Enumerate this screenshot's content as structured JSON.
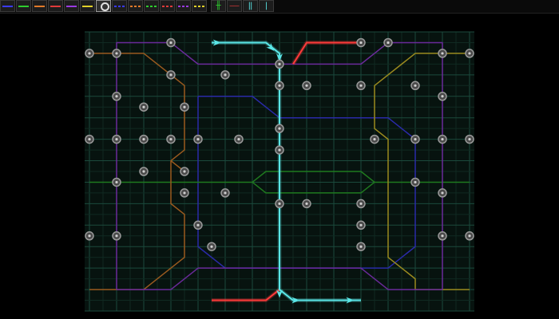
{
  "colors": {
    "background": "#000000",
    "board": "#07130f",
    "grid_minor": "#102a22",
    "grid_major": "#1b4a3c",
    "node_fill": "#4a4a4a",
    "node_ring": "#9a9a9a",
    "lines": {
      "blue": "#2a2aa8",
      "green": "#1f7a1f",
      "orange": "#9a5a1f",
      "red": "#ff3a3a",
      "purple": "#6a2a9a",
      "yellow": "#9a8a1f",
      "cyan": "#5ae6e6"
    }
  },
  "toolbar": {
    "line_tools": [
      {
        "name": "blue-line-tool",
        "color": "#3a3aff",
        "style": "solid"
      },
      {
        "name": "green-line-tool",
        "color": "#2ecc2e",
        "style": "solid"
      },
      {
        "name": "orange-line-tool",
        "color": "#e07a2a",
        "style": "solid"
      },
      {
        "name": "red-line-tool",
        "color": "#e03a3a",
        "style": "solid"
      },
      {
        "name": "purple-line-tool",
        "color": "#9a3ae0",
        "style": "solid"
      },
      {
        "name": "yellow-line-tool",
        "color": "#e0d02a",
        "style": "solid"
      }
    ],
    "station_tool": {
      "name": "station-tool",
      "icon": "station-ring-icon",
      "selected": true
    },
    "dashed_tools": [
      {
        "name": "blue-dashed-tool",
        "color": "#3a3aff",
        "style": "dashed"
      },
      {
        "name": "orange-dashed-tool",
        "color": "#e07a2a",
        "style": "dashed"
      },
      {
        "name": "green-dashed-tool",
        "color": "#2ecc2e",
        "style": "dashed"
      },
      {
        "name": "red-dashed-tool",
        "color": "#e03a3a",
        "style": "dashed"
      },
      {
        "name": "purple-dashed-tool",
        "color": "#9a3ae0",
        "style": "dashed"
      },
      {
        "name": "yellow-dashed-tool",
        "color": "#e0d02a",
        "style": "dashed"
      }
    ],
    "special_tools": [
      {
        "name": "vertical-crossing-tool",
        "icon": "vertical-crossing-icon",
        "color": "#2ecc2e"
      },
      {
        "name": "horizontal-dash-tool",
        "icon": "horizontal-dash-icon",
        "color": "#e03a3a"
      },
      {
        "name": "bridge-tool",
        "icon": "bridge-icon",
        "color": "#5ae6e6"
      },
      {
        "name": "pipe-tool",
        "icon": "pipe-icon",
        "color": "#5ae6e6"
      }
    ]
  },
  "map": {
    "lines": [
      {
        "name": "blue-line",
        "color": "blue",
        "path": [
          [
            4,
            3
          ],
          [
            4,
            10
          ],
          [
            5,
            11
          ],
          [
            11,
            11
          ],
          [
            12,
            10
          ],
          [
            12,
            5
          ],
          [
            11,
            4
          ],
          [
            7,
            4
          ],
          [
            6,
            3
          ],
          [
            4,
            3
          ]
        ]
      },
      {
        "name": "green-line",
        "color": "green",
        "path": [
          [
            0,
            7
          ],
          [
            6,
            7
          ],
          [
            6.5,
            6.5
          ],
          [
            10,
            6.5
          ],
          [
            10.5,
            7
          ],
          [
            14,
            7
          ]
        ]
      },
      {
        "name": "green-line-lower",
        "color": "green",
        "path": [
          [
            6,
            7
          ],
          [
            6.5,
            7.5
          ],
          [
            10,
            7.5
          ],
          [
            10.5,
            7
          ]
        ]
      },
      {
        "name": "orange-line-left",
        "color": "orange",
        "path": [
          [
            0,
            1
          ],
          [
            2,
            1
          ],
          [
            3,
            2
          ],
          [
            3.5,
            2.5
          ],
          [
            3.5,
            5.5
          ],
          [
            3,
            6
          ],
          [
            3,
            8
          ],
          [
            3.5,
            8.5
          ],
          [
            3.5,
            10.5
          ],
          [
            2,
            12
          ],
          [
            0,
            12
          ]
        ]
      },
      {
        "name": "orange-line-mid",
        "color": "orange",
        "path": [
          [
            3,
            6
          ],
          [
            3.5,
            6.5
          ]
        ]
      },
      {
        "name": "yellow-line-right",
        "color": "yellow",
        "path": [
          [
            14,
            1
          ],
          [
            12,
            1
          ],
          [
            10.5,
            2.5
          ],
          [
            10.5,
            4.5
          ],
          [
            11,
            5
          ],
          [
            11,
            9.5
          ],
          [
            11,
            10.5
          ],
          [
            12,
            11.5
          ],
          [
            12,
            12
          ],
          [
            14,
            12
          ]
        ]
      },
      {
        "name": "purple-line-left",
        "color": "purple",
        "path": [
          [
            1,
            12
          ],
          [
            1,
            1
          ],
          [
            1,
            0.5
          ],
          [
            3,
            0.5
          ],
          [
            4,
            1.5
          ],
          [
            7,
            1.5
          ]
        ]
      },
      {
        "name": "purple-line-right",
        "color": "purple",
        "path": [
          [
            13,
            12
          ],
          [
            13,
            1
          ],
          [
            13,
            0.5
          ],
          [
            11,
            0.5
          ],
          [
            10,
            1.5
          ],
          [
            7,
            1.5
          ]
        ]
      },
      {
        "name": "purple-line-bottom",
        "color": "purple",
        "path": [
          [
            1,
            12
          ],
          [
            3,
            12
          ],
          [
            4,
            11
          ],
          [
            7,
            11
          ],
          [
            10,
            11
          ],
          [
            11,
            12
          ],
          [
            13,
            12
          ]
        ]
      },
      {
        "name": "red-line-top",
        "color": "red",
        "path": [
          [
            7.5,
            1.5
          ],
          [
            8,
            0.5
          ],
          [
            10,
            0.5
          ]
        ]
      },
      {
        "name": "red-line-bottom",
        "color": "red",
        "path": [
          [
            4.5,
            12.5
          ],
          [
            6.5,
            12.5
          ],
          [
            7,
            12
          ]
        ]
      },
      {
        "name": "cyan-line",
        "color": "cyan",
        "path": [
          [
            4.5,
            0.5
          ],
          [
            6.5,
            0.5
          ],
          [
            7,
            1
          ],
          [
            7,
            12
          ],
          [
            7.5,
            12.5
          ],
          [
            10,
            12.5
          ]
        ]
      }
    ],
    "stations": [
      [
        3,
        0.5
      ],
      [
        10,
        0.5
      ],
      [
        11,
        0.5
      ],
      [
        0,
        1
      ],
      [
        1,
        1
      ],
      [
        13,
        1
      ],
      [
        14,
        1
      ],
      [
        7,
        1.5
      ],
      [
        3,
        2
      ],
      [
        5,
        2
      ],
      [
        7,
        2.5
      ],
      [
        8,
        2.5
      ],
      [
        10,
        2.5
      ],
      [
        12,
        2.5
      ],
      [
        1,
        3
      ],
      [
        13,
        3
      ],
      [
        2,
        3.5
      ],
      [
        3.5,
        3.5
      ],
      [
        7,
        4.5
      ],
      [
        0,
        5
      ],
      [
        1,
        5
      ],
      [
        2,
        5
      ],
      [
        3,
        5
      ],
      [
        4,
        5
      ],
      [
        5.5,
        5
      ],
      [
        10.5,
        5
      ],
      [
        12,
        5
      ],
      [
        13,
        5
      ],
      [
        14,
        5
      ],
      [
        7,
        5.5
      ],
      [
        2,
        6.5
      ],
      [
        3.5,
        6.5
      ],
      [
        1,
        7
      ],
      [
        12,
        7
      ],
      [
        3.5,
        7.5
      ],
      [
        5,
        7.5
      ],
      [
        13,
        7.5
      ],
      [
        7,
        8
      ],
      [
        8,
        8
      ],
      [
        10,
        8
      ],
      [
        4,
        9
      ],
      [
        10,
        9
      ],
      [
        0,
        9.5
      ],
      [
        1,
        9.5
      ],
      [
        13,
        9.5
      ],
      [
        14,
        9.5
      ],
      [
        4.5,
        10
      ],
      [
        10,
        10
      ]
    ],
    "arrows": [
      {
        "name": "arrow-cyan-start",
        "at": [
          4.7,
          0.5
        ],
        "dir": "right",
        "color": "cyan"
      },
      {
        "name": "arrow-cyan-top",
        "at": [
          6.7,
          0.75
        ],
        "dir": "down-right",
        "color": "cyan"
      },
      {
        "name": "arrow-cyan-junction-top",
        "at": [
          7,
          1.2
        ],
        "dir": "down",
        "color": "cyan"
      },
      {
        "name": "arrow-cyan-junction-bottom",
        "at": [
          7,
          12.2
        ],
        "dir": "down",
        "color": "cyan"
      },
      {
        "name": "arrow-cyan-bottom",
        "at": [
          7.6,
          12.5
        ],
        "dir": "right",
        "color": "cyan"
      },
      {
        "name": "arrow-cyan-end",
        "at": [
          9.6,
          12.5
        ],
        "dir": "right",
        "color": "cyan"
      }
    ],
    "cols": 14,
    "rows": 10
  }
}
